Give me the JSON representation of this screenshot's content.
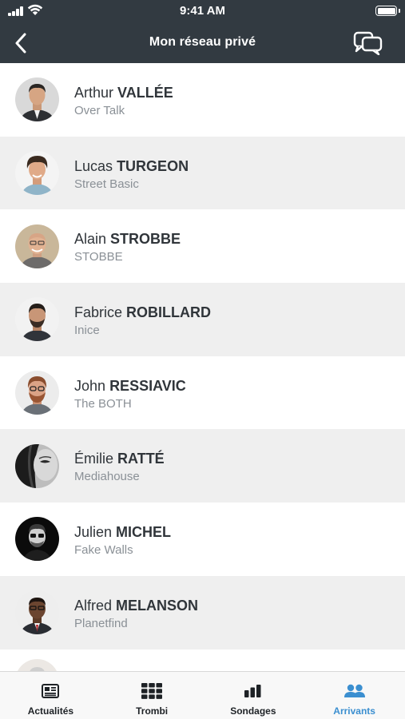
{
  "status_bar": {
    "time": "9:41 AM"
  },
  "header": {
    "title": "Mon réseau privé"
  },
  "contacts": [
    {
      "first": "Arthur",
      "last": "VALLÉE",
      "company": "Over Talk"
    },
    {
      "first": "Lucas",
      "last": "TURGEON",
      "company": "Street Basic"
    },
    {
      "first": "Alain",
      "last": "STROBBE",
      "company": "STOBBE"
    },
    {
      "first": "Fabrice",
      "last": "ROBILLARD",
      "company": "Inice"
    },
    {
      "first": "John",
      "last": "RESSIAVIC",
      "company": "The BOTH"
    },
    {
      "first": "Émilie",
      "last": "RATTÉ",
      "company": "Mediahouse"
    },
    {
      "first": "Julien",
      "last": "MICHEL",
      "company": "Fake Walls"
    },
    {
      "first": "Alfred",
      "last": "MELANSON",
      "company": "Planetfind"
    }
  ],
  "tabs": [
    {
      "label": "Actualités",
      "icon": "newspaper-icon",
      "active": false
    },
    {
      "label": "Trombi",
      "icon": "grid-icon",
      "active": false
    },
    {
      "label": "Sondages",
      "icon": "bar-chart-icon",
      "active": false
    },
    {
      "label": "Arrivants",
      "icon": "people-icon",
      "active": true
    }
  ],
  "colors": {
    "header_bg": "#323a41",
    "active_tab": "#3b8fd0",
    "alt_row": "#efefef"
  }
}
